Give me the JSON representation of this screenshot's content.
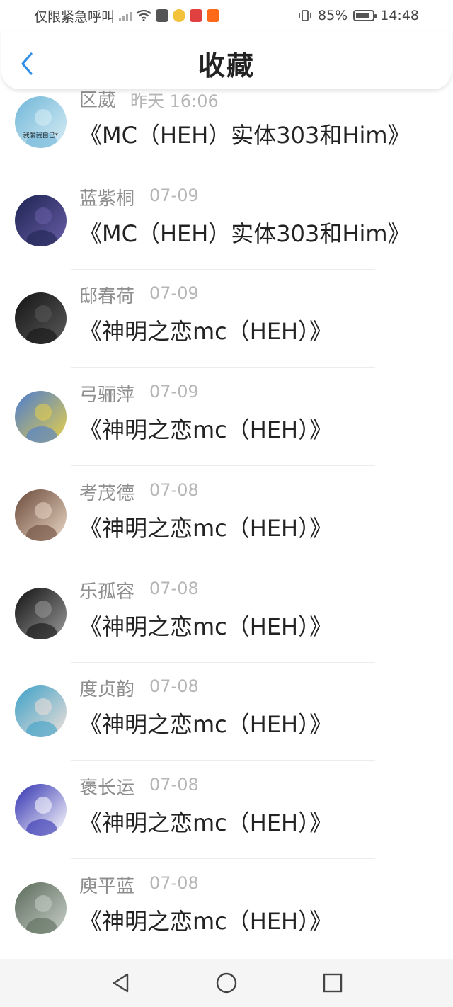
{
  "status_bar": {
    "carrier": "仅限紧急呼叫",
    "battery": "85%",
    "time": "14:48",
    "battery_level": 0.85
  },
  "header": {
    "title": "收藏",
    "back_icon": "chevron-left-icon"
  },
  "items": [
    {
      "name": "区葳",
      "time": "昨天 16:06",
      "content": "《MC（HEH）实体303和Him》",
      "avatar_colors": [
        "#6fb6d8",
        "#d9eef5"
      ],
      "avatar_caption": "我爱我自己*"
    },
    {
      "name": "蓝紫桐",
      "time": "07-09",
      "content": "《MC（HEH）实体303和Him》",
      "avatar_colors": [
        "#1c2350",
        "#6a5fa8"
      ]
    },
    {
      "name": "邸春荷",
      "time": "07-09",
      "content": "《神明之恋mc（HEH）》",
      "avatar_colors": [
        "#141414",
        "#5a5a5a"
      ]
    },
    {
      "name": "弓骊萍",
      "time": "07-09",
      "content": "《神明之恋mc（HEH）》",
      "avatar_colors": [
        "#4a7bd0",
        "#e8d04a"
      ]
    },
    {
      "name": "考茂德",
      "time": "07-08",
      "content": "《神明之恋mc（HEH）》",
      "avatar_colors": [
        "#6b4a3a",
        "#e9d6c4"
      ]
    },
    {
      "name": "乐孤容",
      "time": "07-08",
      "content": "《神明之恋mc（HEH）》",
      "avatar_colors": [
        "#111111",
        "#9a9a9a"
      ]
    },
    {
      "name": "度贞韵",
      "time": "07-08",
      "content": "《神明之恋mc（HEH）》",
      "avatar_colors": [
        "#3aa0c8",
        "#f0e0d8"
      ]
    },
    {
      "name": "褒长运",
      "time": "07-08",
      "content": "《神明之恋mc（HEH）》",
      "avatar_colors": [
        "#3030b0",
        "#ffffff"
      ]
    },
    {
      "name": "庾平蓝",
      "time": "07-08",
      "content": "《神明之恋mc（HEH）》",
      "avatar_colors": [
        "#5a6a5a",
        "#c8cfc8"
      ]
    }
  ],
  "nav": {
    "back": "triangle-back-icon",
    "home": "circle-home-icon",
    "recents": "square-recents-icon"
  }
}
